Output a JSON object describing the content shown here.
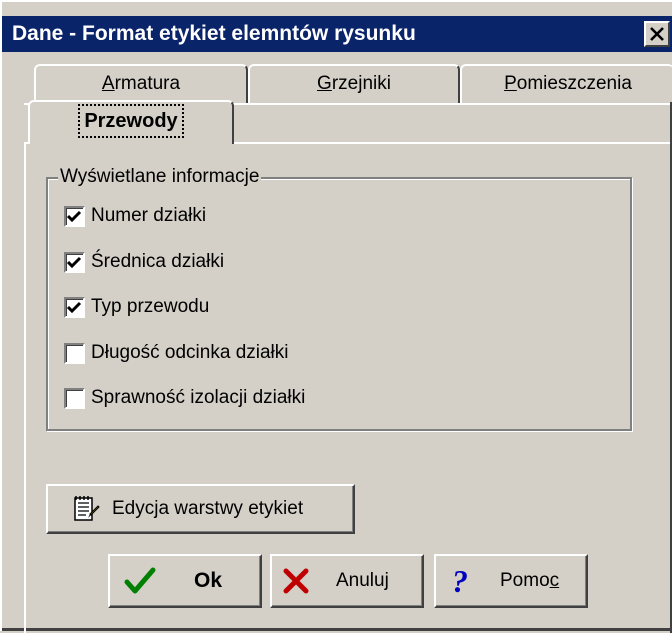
{
  "window": {
    "title": "Dane - Format etykiet elemntów rysunku",
    "close_icon": "close-icon"
  },
  "tabs": {
    "items": [
      {
        "label": "Armatura",
        "underline": "A"
      },
      {
        "label": "Grzejniki",
        "underline": "G"
      },
      {
        "label": "Pomieszczenia",
        "underline": "P"
      },
      {
        "label": "Przewody",
        "active": true
      }
    ]
  },
  "group": {
    "title": "Wyświetlane informacje",
    "options": [
      {
        "label": "Numer działki",
        "checked": true
      },
      {
        "label": "Średnica działki",
        "checked": true
      },
      {
        "label": "Typ przewodu",
        "checked": true
      },
      {
        "label": "Długość odcinka działki",
        "checked": false
      },
      {
        "label": "Sprawność izolacji działki",
        "checked": false
      }
    ]
  },
  "buttons": {
    "edycja": {
      "label": "Edycja warstwy etykiet",
      "icon": "notepad-icon"
    },
    "ok": {
      "label": "Ok",
      "icon": "checkmark-icon"
    },
    "anuluj": {
      "label": "Anuluj",
      "icon": "x-cross-icon"
    },
    "pomoc": {
      "label": "Pomoc",
      "icon": "question-mark-icon"
    }
  },
  "colors": {
    "titlebar": "#0a246a",
    "face": "#d4d0c8",
    "ok_green": "#008000",
    "cancel_red": "#c00000",
    "help_blue": "#0000c0"
  }
}
